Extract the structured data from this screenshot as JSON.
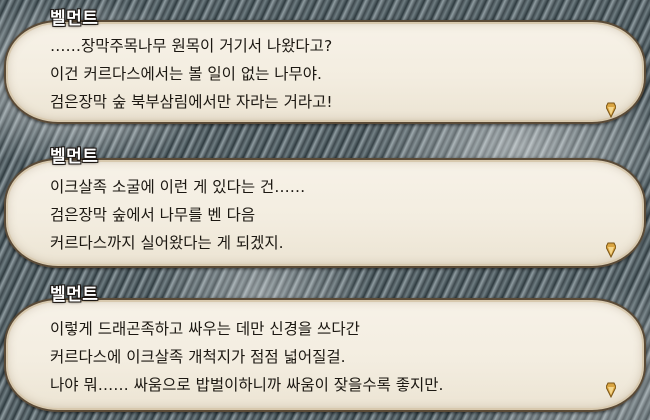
{
  "dialogues": [
    {
      "speaker": "벨먼트",
      "lines": [
        "……장막주목나무 원목이 거기서 나왔다고?",
        "이건 커르다스에서는 볼 일이 없는 나무야.",
        "검은장막 숲 북부삼림에서만 자라는 거라고!"
      ],
      "cursor_icon": "diamond-advance-icon"
    },
    {
      "speaker": "벨먼트",
      "lines": [
        "이크살족 소굴에 이런 게 있다는 건……",
        "검은장막 숲에서 나무를 벤 다음",
        "커르다스까지 실어왔다는 게 되겠지."
      ],
      "cursor_icon": "diamond-advance-icon"
    },
    {
      "speaker": "벨먼트",
      "lines": [
        "이렇게 드래곤족하고 싸우는 데만 신경을 쓰다간",
        "커르다스에 이크살족 개척지가 점점 넓어질걸.",
        "나야 뭐…… 싸움으로 밥벌이하니까 싸움이 잦을수록 좋지만."
      ],
      "cursor_icon": "diamond-advance-icon"
    }
  ],
  "colors": {
    "bubble_fill": "#f5efe3",
    "bubble_border": "#5a4a36",
    "text": "#1c1812",
    "speaker_text": "#ffffff",
    "cursor_gold": "#d9a441"
  }
}
